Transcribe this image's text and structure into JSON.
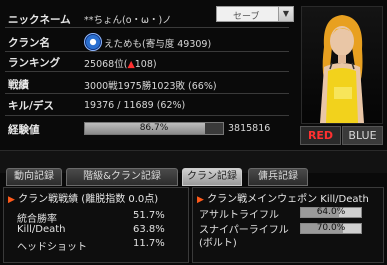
{
  "profile": {
    "nickname_label": "ニックネーム",
    "nickname_value": "**ちょん(o・ω・)ノ",
    "clan_label": "クラン名",
    "clan_value": "えためも(寄与度 49309)",
    "ranking_label": "ランキング",
    "ranking_value": "25068位(",
    "ranking_change_symbol": "▲",
    "ranking_change": "108",
    "ranking_close": ")",
    "record_label": "戦績",
    "record_value": "3000戦1975勝1023敗 (66%)",
    "killdeath_label": "キル/デス",
    "killdeath_value": "19376 / 11689 (62%)",
    "exp_label": "経験値",
    "exp_percent": 86.7,
    "exp_percent_text": "86.7%",
    "exp_points": "3815816"
  },
  "save": {
    "label": "セーブ"
  },
  "teams": {
    "red": "RED",
    "blue": "BLUE"
  },
  "tabs": [
    {
      "label": "動向記録",
      "active": false
    },
    {
      "label": "階級&クラン記録",
      "active": false
    },
    {
      "label": "クラン記録",
      "active": true
    },
    {
      "label": "傭兵記録",
      "active": false
    }
  ],
  "clan_war": {
    "title": "クラン戦戦績 (離脱指数 0.0点)",
    "rows": [
      {
        "label": "統合勝率",
        "value": "51.7%"
      },
      {
        "label": "Kill/Death",
        "value": "63.8%"
      },
      {
        "label": "ヘッドショット",
        "value": "11.7%"
      }
    ]
  },
  "main_weapon": {
    "title": "クラン戦メインウェポン Kill/Death",
    "rows": [
      {
        "label": "アサルトライフル",
        "percent": 64.0,
        "percent_text": "64.0%"
      },
      {
        "label": "スナイパーライフル",
        "label2": "(ボルト)",
        "percent": 70.0,
        "percent_text": "70.0%"
      }
    ]
  },
  "colors": {
    "accent_red": "#ff3030",
    "triangle_orange": "#ff5a1a",
    "background": "#0a0a0a"
  },
  "icons": [
    "clan-emblem-icon",
    "triangle-up-icon",
    "dropdown-arrow-icon",
    "triangle-right-icon"
  ]
}
